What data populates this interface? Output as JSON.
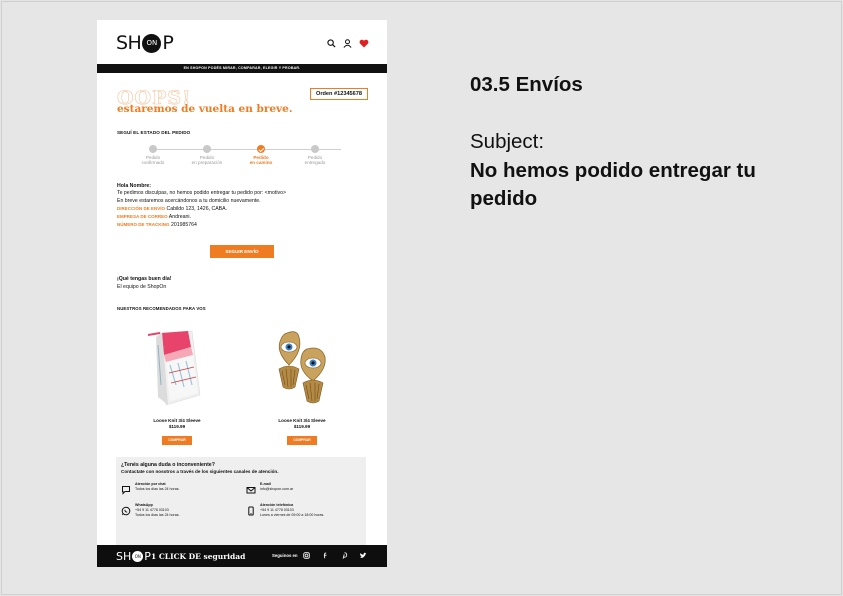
{
  "email": {
    "header": {
      "logo_left": "SH",
      "logo_on": "ON",
      "logo_right": "P",
      "icons": [
        "search-icon",
        "user-icon",
        "heart-icon"
      ]
    },
    "promo_bar": "EN SHOPON PODÉS MIRAR, COMPARAR, ELEGIR Y PROBAR.",
    "hero": {
      "oops": "OOPS!",
      "headline": "estaremos de vuelta en breve.",
      "order": "Orden #12345678"
    },
    "tracker": {
      "title": "SEGUÍ EL ESTADO DEL PEDIDO",
      "steps": [
        {
          "line1": "Pedido",
          "line2": "confirmado",
          "active": false
        },
        {
          "line1": "Pedido",
          "line2": "en preparación",
          "active": false
        },
        {
          "line1": "Pedido",
          "line2": "en camino",
          "active": true
        },
        {
          "line1": "Pedido",
          "line2": "entregado",
          "active": false
        }
      ]
    },
    "message": {
      "greeting": "Hola Nombre:",
      "line1": "Te pedimos disculpas, no hemos podido entregar tu pedido por: <motivo>",
      "line2": "En breve estaremos acercándonos a tu domicilio nuevamente.",
      "address_key": "DIRECCIÓN DE ENVÍO",
      "address_val": "Cabildo 123, 1426, CABA.",
      "courier_key": "EMPRESA DE CORREO",
      "courier_val": "Andreani.",
      "tracking_key": "NÚMERO DE TRACKING",
      "tracking_val": "201985764"
    },
    "cta_label": "SEGUIR ENVÍO",
    "signoff": {
      "line1": "¡Qué tengas buen día!",
      "line2": "El equipo de ShopOn"
    },
    "recos_title": "NUESTROS RECOMENDADOS PARA VOS",
    "products": [
      {
        "name": "Loose Knit 3/4 Sleeve",
        "price": "$119.99",
        "button": "COMPRAR"
      },
      {
        "name": "Loose Knit 3/4 Sleeve",
        "price": "$119.99",
        "button": "COMPRAR"
      }
    ],
    "help": {
      "question": "¿Tenés alguna duda o inconveniente?",
      "subtitle": "Contactate con nosotros a través de los siguientes canales de atención.",
      "channels": [
        {
          "icon": "chat-icon",
          "title": "Atención por chat",
          "line1": "Todos los días las 24 horas.",
          "line2": ""
        },
        {
          "icon": "email-icon",
          "title": "E-mail",
          "line1": "info@shopon.com.ar",
          "line2": ""
        },
        {
          "icon": "whatsapp-icon",
          "title": "WhatsApp",
          "line1": "+54 9 11 4778 03103",
          "line2": "Todos los días las 24 horas."
        },
        {
          "icon": "phone-icon",
          "title": "Atención telefónica",
          "line1": "+54 9 11 4778 03103",
          "line2": "Lunes a viernes de 09:00 a 18:00 horas."
        }
      ]
    },
    "footer": {
      "logo_left": "SH",
      "logo_on": "ON",
      "logo_right": "P",
      "tagline": "1 CLICK DE seguridad",
      "follow": "Seguinos en",
      "social": [
        "instagram-icon",
        "facebook-icon",
        "pinterest-icon",
        "twitter-icon"
      ]
    }
  },
  "spec": {
    "section": "03.5 Envíos",
    "subject_label": "Subject:",
    "subject_value": "No hemos podido entregar tu pedido"
  },
  "colors": {
    "accent": "#ef7b23",
    "dark": "#111111",
    "panel": "#efefef"
  }
}
